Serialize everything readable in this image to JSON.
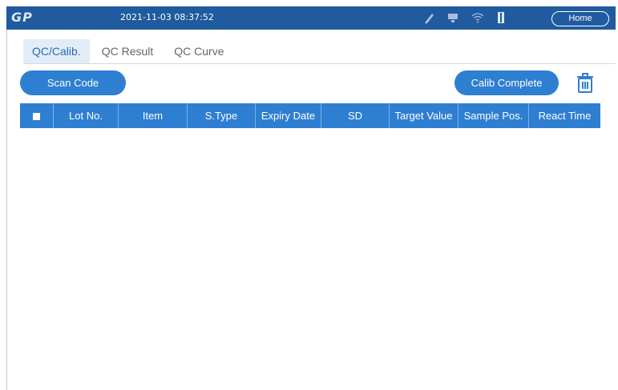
{
  "header": {
    "logo": "GP",
    "datetime": "2021-11-03 08:37:52",
    "home_label": "Home",
    "status_icons": [
      "pen-icon",
      "monitor-icon",
      "wifi-icon",
      "door-icon"
    ],
    "bar_color": "#1f5b9e"
  },
  "tabs": [
    {
      "label": "QC/Calib.",
      "active": true
    },
    {
      "label": "QC Result",
      "active": false
    },
    {
      "label": "QC Curve",
      "active": false
    }
  ],
  "toolbar": {
    "scan_label": "Scan Code",
    "calib_label": "Calib Complete",
    "accent_color": "#2e7fd2"
  },
  "table": {
    "columns": [
      "Lot No.",
      "Item",
      "S.Type",
      "Expiry Date",
      "SD",
      "Target Value",
      "Sample Pos.",
      "React Time"
    ],
    "rows": []
  }
}
